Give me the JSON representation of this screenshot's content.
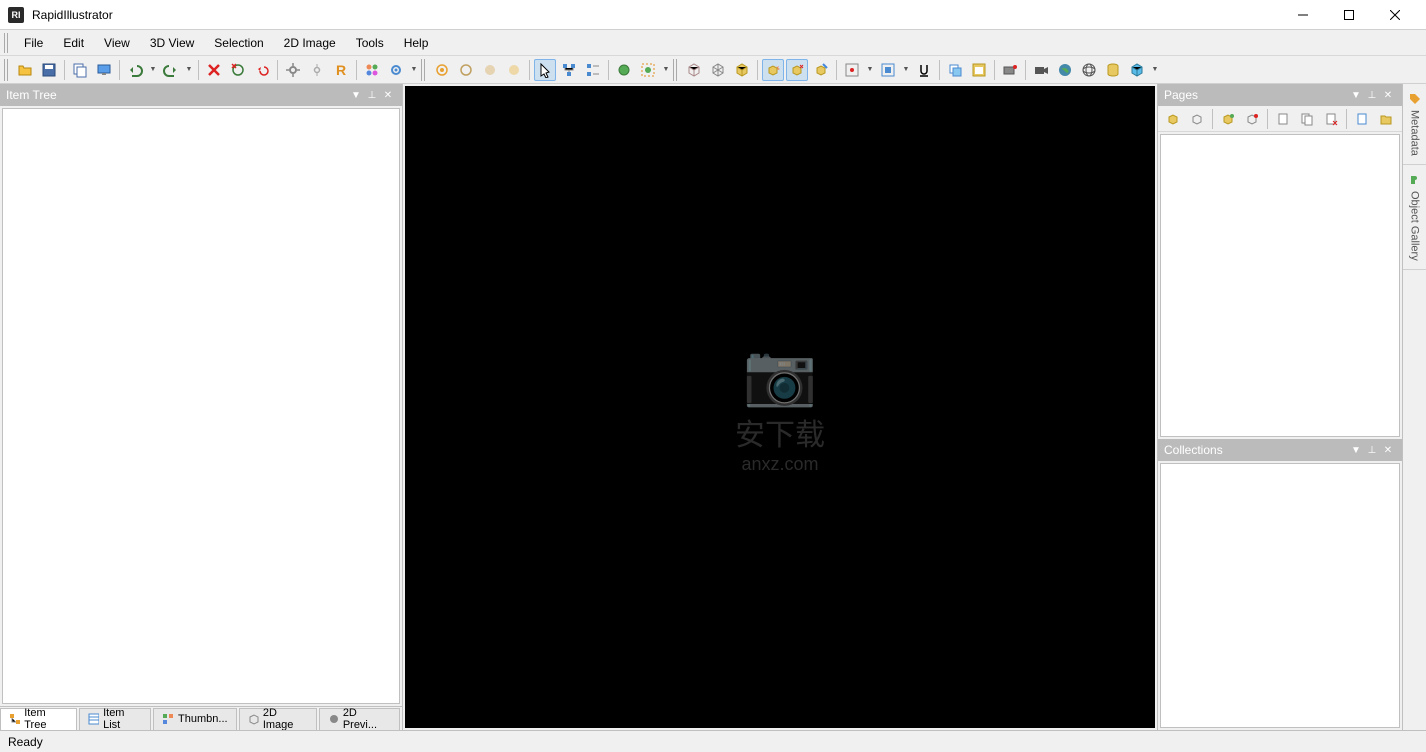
{
  "app": {
    "title": "RapidIllustrator",
    "icon_label": "RI"
  },
  "menu": {
    "items": [
      "File",
      "Edit",
      "View",
      "3D View",
      "Selection",
      "2D Image",
      "Tools",
      "Help"
    ]
  },
  "toolbar": {
    "main": [
      {
        "icon": "open-icon",
        "name": "open-button"
      },
      {
        "icon": "save-icon",
        "name": "save-button"
      },
      {
        "sep": true
      },
      {
        "icon": "copy-icon",
        "name": "copy-button"
      },
      {
        "icon": "monitor-icon",
        "name": "monitor-button"
      },
      {
        "sep": true
      },
      {
        "icon": "undo-icon",
        "name": "undo-button",
        "drop": true
      },
      {
        "icon": "redo-icon",
        "name": "redo-button",
        "drop": true
      },
      {
        "sep": true
      },
      {
        "icon": "delete-x-icon",
        "name": "delete-button"
      },
      {
        "icon": "refresh-x-icon",
        "name": "delete-refresh-button"
      },
      {
        "icon": "undo-x-icon",
        "name": "undo-x-button"
      },
      {
        "sep": true
      },
      {
        "icon": "gear-icon",
        "name": "gear1-button"
      },
      {
        "icon": "gear-sm-icon",
        "name": "gear2-button"
      },
      {
        "icon": "r-icon",
        "name": "r-button"
      },
      {
        "sep": true
      },
      {
        "icon": "cluster-icon",
        "name": "cluster-button"
      },
      {
        "icon": "settings-icon",
        "name": "settings-button"
      },
      {
        "drop": true
      }
    ],
    "second": [
      {
        "handle": true
      },
      {
        "icon": "circle1-icon",
        "name": "orbit-button"
      },
      {
        "icon": "circle2-icon",
        "name": "circle2-button"
      },
      {
        "icon": "circle3-icon",
        "name": "circle3-button"
      },
      {
        "icon": "circle4-icon",
        "name": "circle4-button"
      },
      {
        "sep": true
      },
      {
        "icon": "pointer-icon",
        "name": "pointer-button",
        "active": true
      },
      {
        "icon": "hierarchy-icon",
        "name": "hierarchy-button"
      },
      {
        "icon": "list-icon",
        "name": "list-button"
      },
      {
        "sep": true
      },
      {
        "icon": "world-icon",
        "name": "world-button"
      },
      {
        "icon": "globe-select-icon",
        "name": "globe-select-button"
      },
      {
        "drop": true
      }
    ],
    "third": [
      {
        "handle": true
      },
      {
        "icon": "cube1-icon",
        "name": "cube1-button"
      },
      {
        "icon": "cube2-icon",
        "name": "cube2-button"
      },
      {
        "icon": "box-icon",
        "name": "box-button"
      },
      {
        "sep": true
      },
      {
        "icon": "star-cube-icon",
        "name": "star-cube-button",
        "active": true
      },
      {
        "icon": "move-cube-icon",
        "name": "move-cube-button",
        "active": true
      },
      {
        "icon": "brush-cube-icon",
        "name": "brush-cube-button"
      },
      {
        "sep": true
      },
      {
        "icon": "center-icon",
        "name": "center-button",
        "drop": true
      },
      {
        "icon": "fit-icon",
        "name": "fit-button",
        "drop": true
      },
      {
        "icon": "underline-icon",
        "name": "underline-button"
      },
      {
        "sep": true
      },
      {
        "icon": "layer-icon",
        "name": "layer-button"
      },
      {
        "icon": "window-icon",
        "name": "window-button"
      },
      {
        "sep": true
      },
      {
        "icon": "camera-icon",
        "name": "anim-button"
      },
      {
        "sep": true
      },
      {
        "icon": "video-icon",
        "name": "video-button"
      },
      {
        "icon": "earth-icon",
        "name": "earth-button"
      },
      {
        "icon": "globe2-icon",
        "name": "globe2-button"
      },
      {
        "icon": "cylinder-icon",
        "name": "cylinder-button"
      },
      {
        "icon": "cube3d-icon",
        "name": "cube3d-button"
      },
      {
        "drop": true
      }
    ]
  },
  "panels": {
    "left_title": "Item Tree",
    "pages_title": "Pages",
    "collections_title": "Collections"
  },
  "sidetabs": {
    "items": [
      {
        "label": "Metadata",
        "icon": "tag-icon"
      },
      {
        "label": "Object Gallery",
        "icon": "puzzle-icon"
      }
    ]
  },
  "bottomtabs": {
    "items": [
      {
        "label": "Item Tree",
        "active": true
      },
      {
        "label": "Item List",
        "active": false
      },
      {
        "label": "Thumbn...",
        "active": false
      },
      {
        "label": "2D Image",
        "active": false
      },
      {
        "label": "2D Previ...",
        "active": false
      }
    ]
  },
  "status": {
    "text": "Ready"
  },
  "watermark": {
    "text": "安下载",
    "sub": "anxz.com"
  }
}
